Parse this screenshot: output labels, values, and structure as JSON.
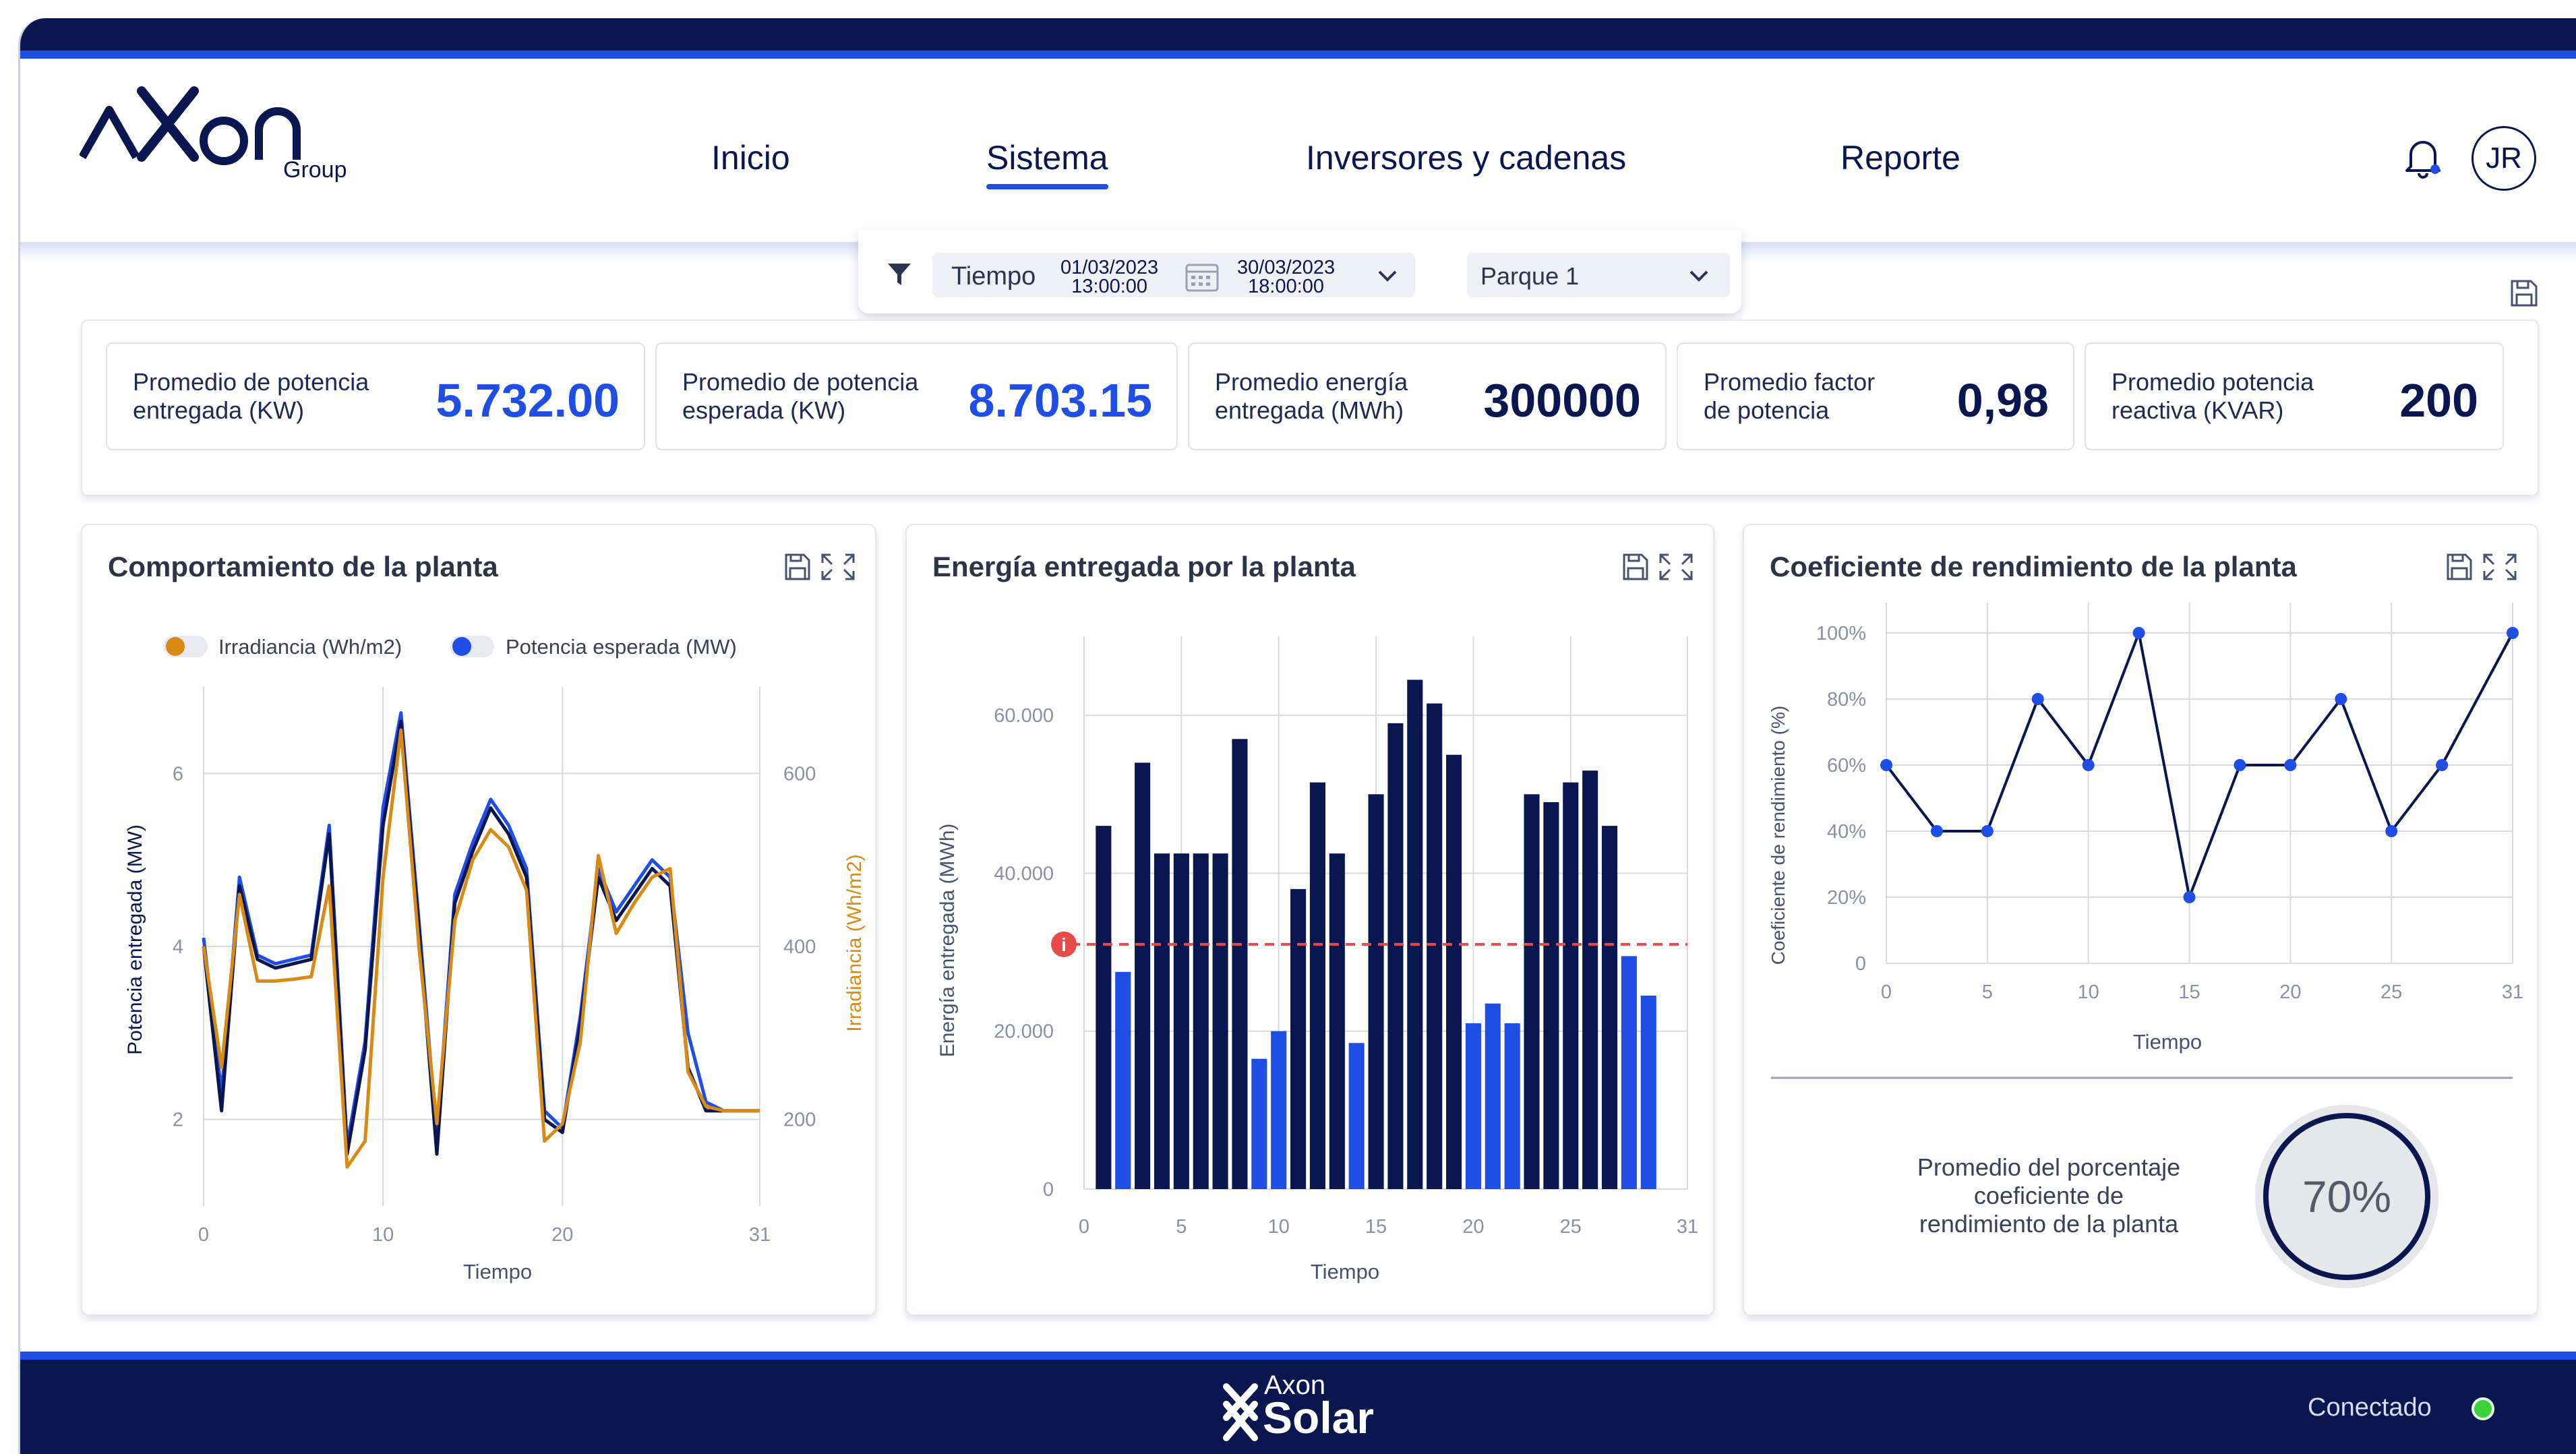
{
  "brand": {
    "logo_text": "Axon",
    "group_text": "Group",
    "footer_small": "Axon",
    "footer_big": "Solar"
  },
  "nav": {
    "items": [
      {
        "label": "Inicio",
        "active": false
      },
      {
        "label": "Sistema",
        "active": true
      },
      {
        "label": "Inversores y cadenas",
        "active": false
      },
      {
        "label": "Reporte",
        "active": false
      }
    ],
    "avatar": "JR"
  },
  "filters": {
    "time_label": "Tiempo",
    "start_date": "01/03/2023",
    "start_time": "13:00:00",
    "end_date": "30/03/2023",
    "end_time": "18:00:00",
    "park": "Parque 1"
  },
  "kpis": [
    {
      "label_1": "Promedio de potencia",
      "label_2": "entregada (KW)",
      "value": "5.732.00",
      "color": "#1f4ee6"
    },
    {
      "label_1": "Promedio de potencia",
      "label_2": "esperada (KW)",
      "value": "8.703.15",
      "color": "#1f4ee6"
    },
    {
      "label_1": "Promedio energía",
      "label_2": "entregada (MWh)",
      "value": "300000",
      "color": "#0a1650"
    },
    {
      "label_1": "Promedio factor",
      "label_2": "de potencia",
      "value": "0,98",
      "color": "#0a1650"
    },
    {
      "label_1": "Promedio potencia",
      "label_2": "reactiva (KVAR)",
      "value": "200",
      "color": "#0a1650"
    }
  ],
  "cards": {
    "plant_behavior": {
      "title": "Comportamiento de la planta"
    },
    "energy": {
      "title": "Energía entregada por la planta"
    },
    "performance": {
      "title": "Coeficiente de rendimiento de la planta",
      "avg_label_1": "Promedio del porcentaje",
      "avg_label_2": "coeficiente de",
      "avg_label_3": "rendimiento de la planta",
      "avg_value": "70%",
      "avg_fraction": 0.7
    }
  },
  "status": {
    "label": "Conectado",
    "color": "#3bd13b"
  },
  "colors": {
    "navy": "#0a1650",
    "blue": "#1f4ee6",
    "orange": "#d98a12",
    "red": "#e84a4a"
  },
  "chart_data": [
    {
      "type": "line",
      "title": "Comportamiento de la planta",
      "xlabel": "Tiempo",
      "ylabel": "Potencia entregada (MW)",
      "y2label": "Irradiancia (Wh/m2)",
      "xlim": [
        0,
        31
      ],
      "ylim": [
        1,
        7
      ],
      "y2lim": [
        100,
        700
      ],
      "x_ticks": [
        0,
        10,
        20,
        31
      ],
      "y_ticks": [
        2,
        4,
        6
      ],
      "y2_ticks": [
        200,
        400,
        600
      ],
      "legend": [
        "Irradiancia (Wh/m2)",
        "Potencia esperada (MW)"
      ],
      "x": [
        0,
        1,
        2,
        3,
        4,
        5,
        6,
        7,
        8,
        9,
        10,
        11,
        12,
        13,
        14,
        15,
        16,
        17,
        18,
        19,
        20,
        21,
        22,
        23,
        24,
        25,
        26,
        27,
        28,
        29,
        30,
        31
      ],
      "series": [
        {
          "name": "Potencia esperada (MW)",
          "axis": "y",
          "color": "#1f4ee6",
          "values": [
            4.1,
            2.3,
            4.8,
            3.9,
            3.8,
            3.85,
            3.9,
            5.4,
            1.7,
            2.9,
            5.6,
            6.7,
            4.3,
            1.8,
            4.6,
            5.2,
            5.7,
            5.4,
            4.9,
            2.1,
            1.9,
            3.2,
            4.9,
            4.4,
            4.7,
            5.0,
            4.8,
            3.0,
            2.2,
            2.1,
            2.1,
            2.1
          ]
        },
        {
          "name": "Potencia entregada",
          "axis": "y",
          "color": "#0a1650",
          "values": [
            4.0,
            2.1,
            4.7,
            3.85,
            3.75,
            3.8,
            3.85,
            5.3,
            1.6,
            2.8,
            5.4,
            6.6,
            4.2,
            1.6,
            4.5,
            5.1,
            5.6,
            5.3,
            4.8,
            2.0,
            1.85,
            3.1,
            4.8,
            4.3,
            4.6,
            4.9,
            4.7,
            2.6,
            2.1,
            2.1,
            2.1,
            2.1
          ]
        },
        {
          "name": "Irradiancia (Wh/m2)",
          "axis": "y2",
          "color": "#d98a12",
          "values": [
            400,
            260,
            460,
            360,
            360,
            362,
            365,
            470,
            145,
            175,
            480,
            650,
            400,
            195,
            430,
            500,
            535,
            515,
            465,
            175,
            195,
            290,
            505,
            415,
            450,
            480,
            490,
            255,
            215,
            210,
            210,
            210
          ]
        }
      ]
    },
    {
      "type": "bar",
      "title": "Energía entregada por la planta",
      "xlabel": "Tiempo",
      "ylabel": "Energía entregada (MWh)",
      "xlim": [
        0,
        31
      ],
      "ylim": [
        0,
        70000
      ],
      "x_ticks": [
        0,
        5,
        10,
        15,
        20,
        25,
        31
      ],
      "y_ticks": [
        0,
        20000,
        40000,
        60000
      ],
      "y_tick_labels": [
        "0",
        "20.000",
        "40.000",
        "60.000"
      ],
      "reference_line": 31000,
      "x": [
        1,
        2,
        3,
        4,
        5,
        6,
        7,
        8,
        9,
        10,
        11,
        12,
        13,
        14,
        15,
        16,
        17,
        18,
        19,
        20,
        21,
        22,
        23,
        24,
        25,
        26,
        27,
        28,
        29,
        30
      ],
      "values": [
        46000,
        27500,
        54000,
        42500,
        42500,
        42500,
        42500,
        57000,
        16500,
        20000,
        38000,
        51500,
        42500,
        18500,
        50000,
        59000,
        64500,
        61500,
        55000,
        21000,
        23500,
        21000,
        50000,
        49000,
        51500,
        53000,
        46000,
        29500,
        24500,
        0
      ],
      "highlight": [
        false,
        true,
        false,
        false,
        false,
        false,
        false,
        false,
        true,
        true,
        false,
        false,
        false,
        true,
        false,
        false,
        false,
        false,
        false,
        true,
        true,
        true,
        false,
        false,
        false,
        false,
        false,
        true,
        true,
        false
      ]
    },
    {
      "type": "line",
      "title": "Coeficiente de rendimiento de la planta",
      "xlabel": "Tiempo",
      "ylabel": "Coeficiente de rendimiento (%)",
      "xlim": [
        0,
        31
      ],
      "ylim": [
        0,
        100
      ],
      "x_ticks": [
        0,
        5,
        10,
        15,
        20,
        25,
        31
      ],
      "y_ticks": [
        0,
        20,
        40,
        60,
        80,
        100
      ],
      "y_tick_labels": [
        "0",
        "20%",
        "40%",
        "60%",
        "80%",
        "100%"
      ],
      "x": [
        0,
        2.5,
        5,
        7.5,
        10,
        12.5,
        15,
        17.5,
        20,
        22.5,
        25,
        27.5,
        31
      ],
      "values": [
        60,
        40,
        40,
        80,
        60,
        100,
        20,
        60,
        60,
        80,
        40,
        60,
        100
      ]
    }
  ]
}
